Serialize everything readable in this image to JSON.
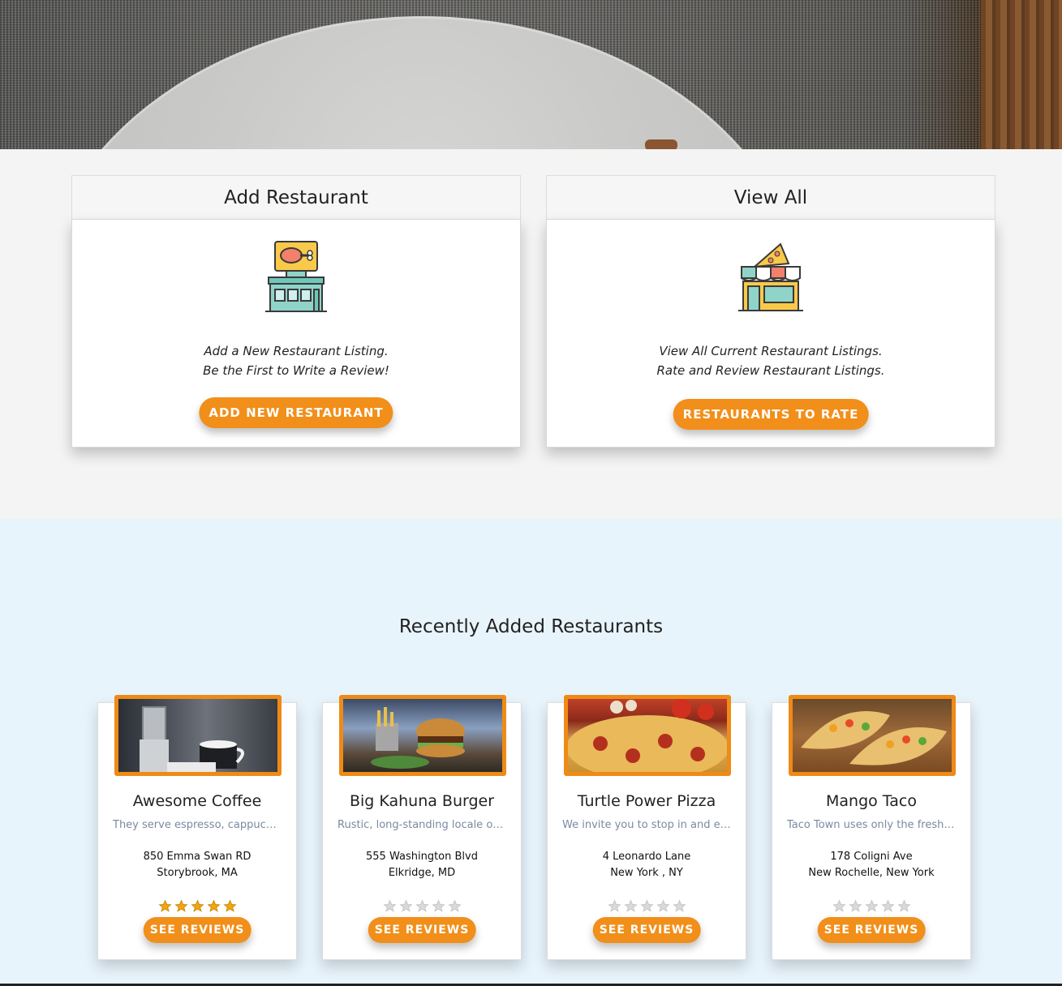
{
  "colors": {
    "accent": "#f18f1a",
    "page_bg": "#f4f4f4",
    "recent_bg": "#e8f4fc",
    "star_filled": "#f2a60c",
    "star_empty": "#d9d9d9"
  },
  "hero": {
    "image": "plate-on-placemat-photo"
  },
  "add_card": {
    "title": "Add Restaurant",
    "icon": "restaurant-drumstick-sign-icon",
    "line1": "Add a New Restaurant Listing.",
    "line2": "Be the First to Write a Review!",
    "button": "ADD NEW RESTAURANT"
  },
  "view_card": {
    "title": "View All",
    "icon": "pizza-shop-storefront-icon",
    "line1": "View All Current Restaurant Listings.",
    "line2": "Rate and Review Restaurant Listings.",
    "button": "RESTAURANTS TO RATE"
  },
  "recent": {
    "title": "Recently Added Restaurants",
    "restaurants": [
      {
        "name": "Awesome Coffee",
        "blurb": "They serve espresso, cappuccino, lattes and more",
        "address1": "850 Emma Swan RD",
        "address2": "Storybrook, MA",
        "rating": 5,
        "photo": "coffee-photo",
        "button": "SEE REVIEWS"
      },
      {
        "name": "Big Kahuna Burger",
        "blurb": "Rustic, long-standing locale offering burgers and fries",
        "address1": "555 Washington Blvd",
        "address2": "Elkridge, MD",
        "rating": 0,
        "photo": "burger-photo",
        "button": "SEE REVIEWS"
      },
      {
        "name": "Turtle Power Pizza",
        "blurb": "We invite you to stop in and enjoy a slice",
        "address1": "4 Leonardo Lane",
        "address2": "New York , NY",
        "rating": 0,
        "photo": "pizza-photo",
        "button": "SEE REVIEWS"
      },
      {
        "name": "Mango Taco",
        "blurb": "Taco Town uses only the freshest ingredients",
        "address1": "178 Coligni Ave",
        "address2": "New Rochelle, New York",
        "rating": 0,
        "photo": "taco-photo",
        "button": "SEE REVIEWS"
      }
    ]
  }
}
